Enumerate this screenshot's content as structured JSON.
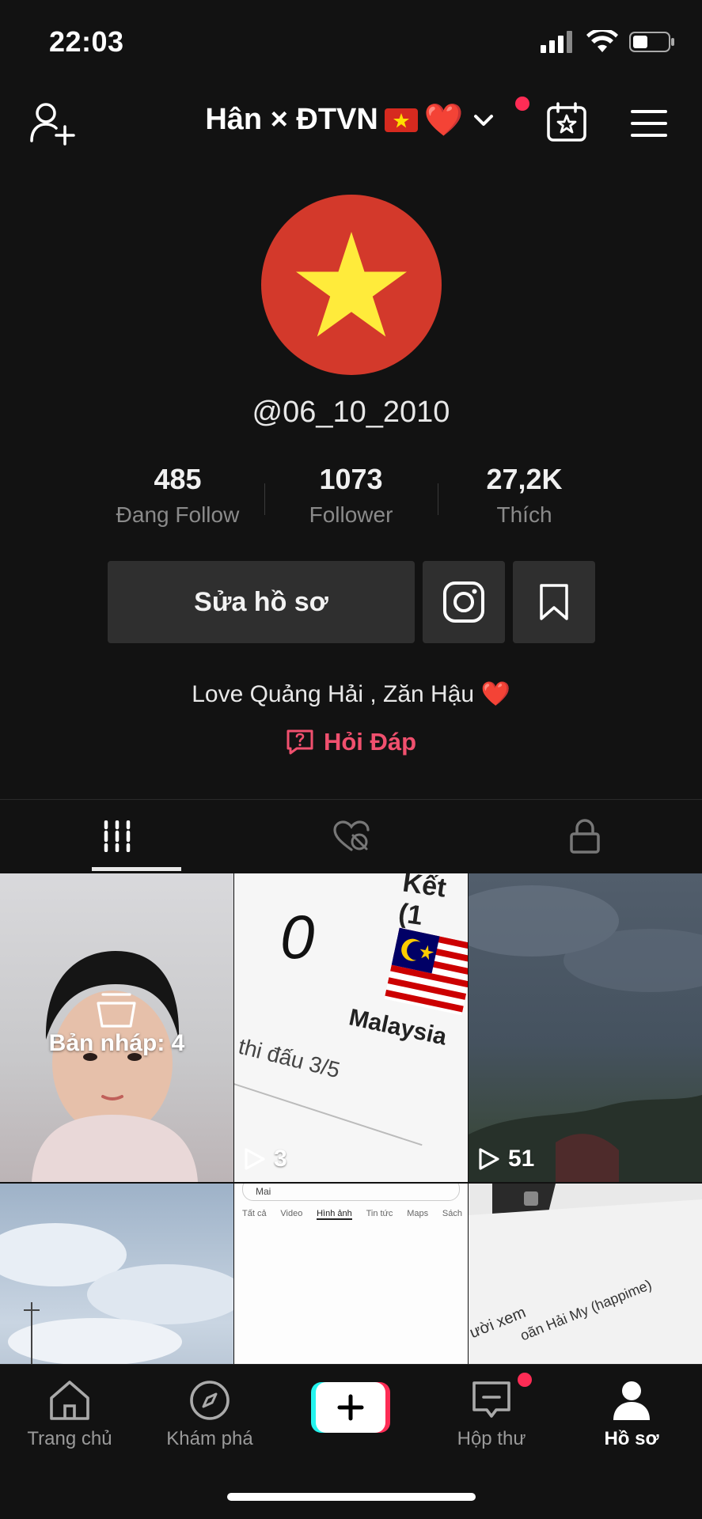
{
  "status_bar": {
    "time": "22:03"
  },
  "header": {
    "account_name": "Hân × ĐTVN",
    "icons": [
      "add-user-icon",
      "chevron-down-icon",
      "calendar-star-icon",
      "menu-icon"
    ]
  },
  "profile": {
    "username": "@06_10_2010",
    "stats": [
      {
        "value": "485",
        "label": "Đang Follow"
      },
      {
        "value": "1073",
        "label": "Follower"
      },
      {
        "value": "27,2K",
        "label": "Thích"
      }
    ],
    "edit_button": "Sửa hồ sơ",
    "bio": "Love Quảng Hải , Zăn Hậu",
    "qa_label": "Hỏi Đáp"
  },
  "tabs": [
    {
      "name": "videos",
      "icon": "grid-icon",
      "active": true
    },
    {
      "name": "liked",
      "icon": "hidden-heart-icon",
      "active": false
    },
    {
      "name": "private",
      "icon": "lock-icon",
      "active": false
    }
  ],
  "videos": [
    {
      "type": "draft",
      "label": "Bản nháp: 4"
    },
    {
      "type": "video",
      "plays": "3",
      "thumb_number": "0",
      "thumb_country": "Malaysia",
      "thumb_text": "thi đấu 3/5",
      "thumb_top": "Kết (1"
    },
    {
      "type": "video",
      "plays": "51"
    },
    {
      "type": "video",
      "plays": ""
    },
    {
      "type": "video",
      "plays": "",
      "search_tabs": [
        "Tất cả",
        "Video",
        "Hình ảnh",
        "Tin tức",
        "Maps",
        "Sách"
      ],
      "search_query": "Mai"
    },
    {
      "type": "video",
      "plays": "",
      "thumb_text_1": "ười xem",
      "thumb_text_2": "oãn Hải My (happime)"
    }
  ],
  "bottom_nav": [
    {
      "label": "Trang chủ",
      "icon": "home-icon",
      "active": false
    },
    {
      "label": "Khám phá",
      "icon": "compass-icon",
      "active": false
    },
    {
      "label": "",
      "icon": "plus-icon",
      "active": false
    },
    {
      "label": "Hộp thư",
      "icon": "inbox-icon",
      "active": false
    },
    {
      "label": "Hồ sơ",
      "icon": "profile-icon",
      "active": true
    }
  ],
  "colors": {
    "background": "#121212",
    "accent": "#fe2c55",
    "qa": "#f0506e",
    "avatar": "#d3392b",
    "star": "#ffeb3b"
  }
}
